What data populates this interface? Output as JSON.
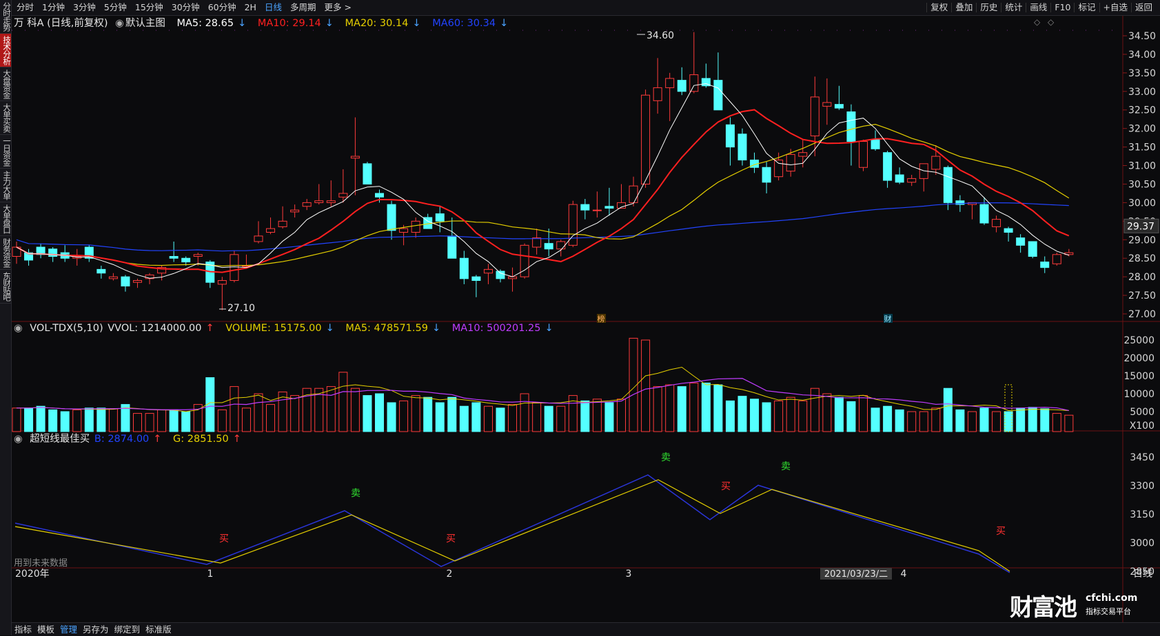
{
  "toolbar": {
    "periods": [
      "分时",
      "1分钟",
      "3分钟",
      "5分钟",
      "15分钟",
      "30分钟",
      "60分钟",
      "2H",
      "日线",
      "多周期",
      "更多 >"
    ],
    "active_period": "日线",
    "right_buttons": [
      "复权",
      "叠加",
      "历史",
      "统计",
      "画线",
      "F10",
      "标记",
      "+自选",
      "返回"
    ]
  },
  "side_tabs": [
    "分时走势",
    "技术分析",
    "大盘资金",
    "大单买卖",
    "一日资金",
    "主力大单",
    "大单盘口",
    "财务资金",
    "东财贴吧"
  ],
  "side_active": "技术分析",
  "main": {
    "title": "万 科A (日线,前复权)",
    "template": "默认主图",
    "ma5": "MA5: 28.65",
    "ma10": "MA10: 29.14",
    "ma20": "MA20: 30.14",
    "ma60": "MA60: 30.34",
    "high_label": "34.60",
    "low_label": "27.10",
    "price_axis": [
      "34.50",
      "34.00",
      "33.50",
      "33.00",
      "32.50",
      "32.00",
      "31.50",
      "31.00",
      "30.50",
      "30.00",
      "29.50",
      "29.00",
      "28.50",
      "28.00",
      "27.50",
      "27.00"
    ],
    "current_price": "29.37",
    "marker_bang": "榜",
    "marker_cai": "财"
  },
  "vol": {
    "title": "VOL-TDX(5,10)",
    "vvol": "VVOL: 1214000.00",
    "volume": "VOLUME: 15175.00",
    "ma5": "MA5: 478571.59",
    "ma10": "MA10: 500201.25",
    "axis": [
      "25000",
      "20000",
      "15000",
      "10000",
      "5000",
      "X100"
    ]
  },
  "ind": {
    "title": "超短线最佳买",
    "b": "B: 2874.00",
    "g": "G: 2851.50",
    "axis": [
      "3450",
      "3300",
      "3150",
      "3000",
      "2850"
    ],
    "future_note": "用到未来数据",
    "signals": [
      "买",
      "卖",
      "买",
      "卖",
      "买",
      "卖",
      "买"
    ]
  },
  "time_axis": {
    "year": "2020年",
    "months": [
      "1",
      "2",
      "3",
      "4"
    ],
    "cursor_date": "2021/03/23/二"
  },
  "bottom_tabs": [
    "指标",
    "模板",
    "管理",
    "另存为",
    "绑定到",
    "标准版"
  ],
  "bottom_active": "管理",
  "logo": {
    "main": "财富池",
    "site": "cfchi.com",
    "tagline": "指标交易平台"
  },
  "corner_label": "日线",
  "colors": {
    "up": "#ff3b3b",
    "down": "#54ffff",
    "ma5": "#ffffff",
    "ma10": "#ff2020",
    "ma20": "#e6d000",
    "ma60": "#2244ff",
    "vma10": "#c03cff",
    "accent": "#4aa3ff"
  }
}
